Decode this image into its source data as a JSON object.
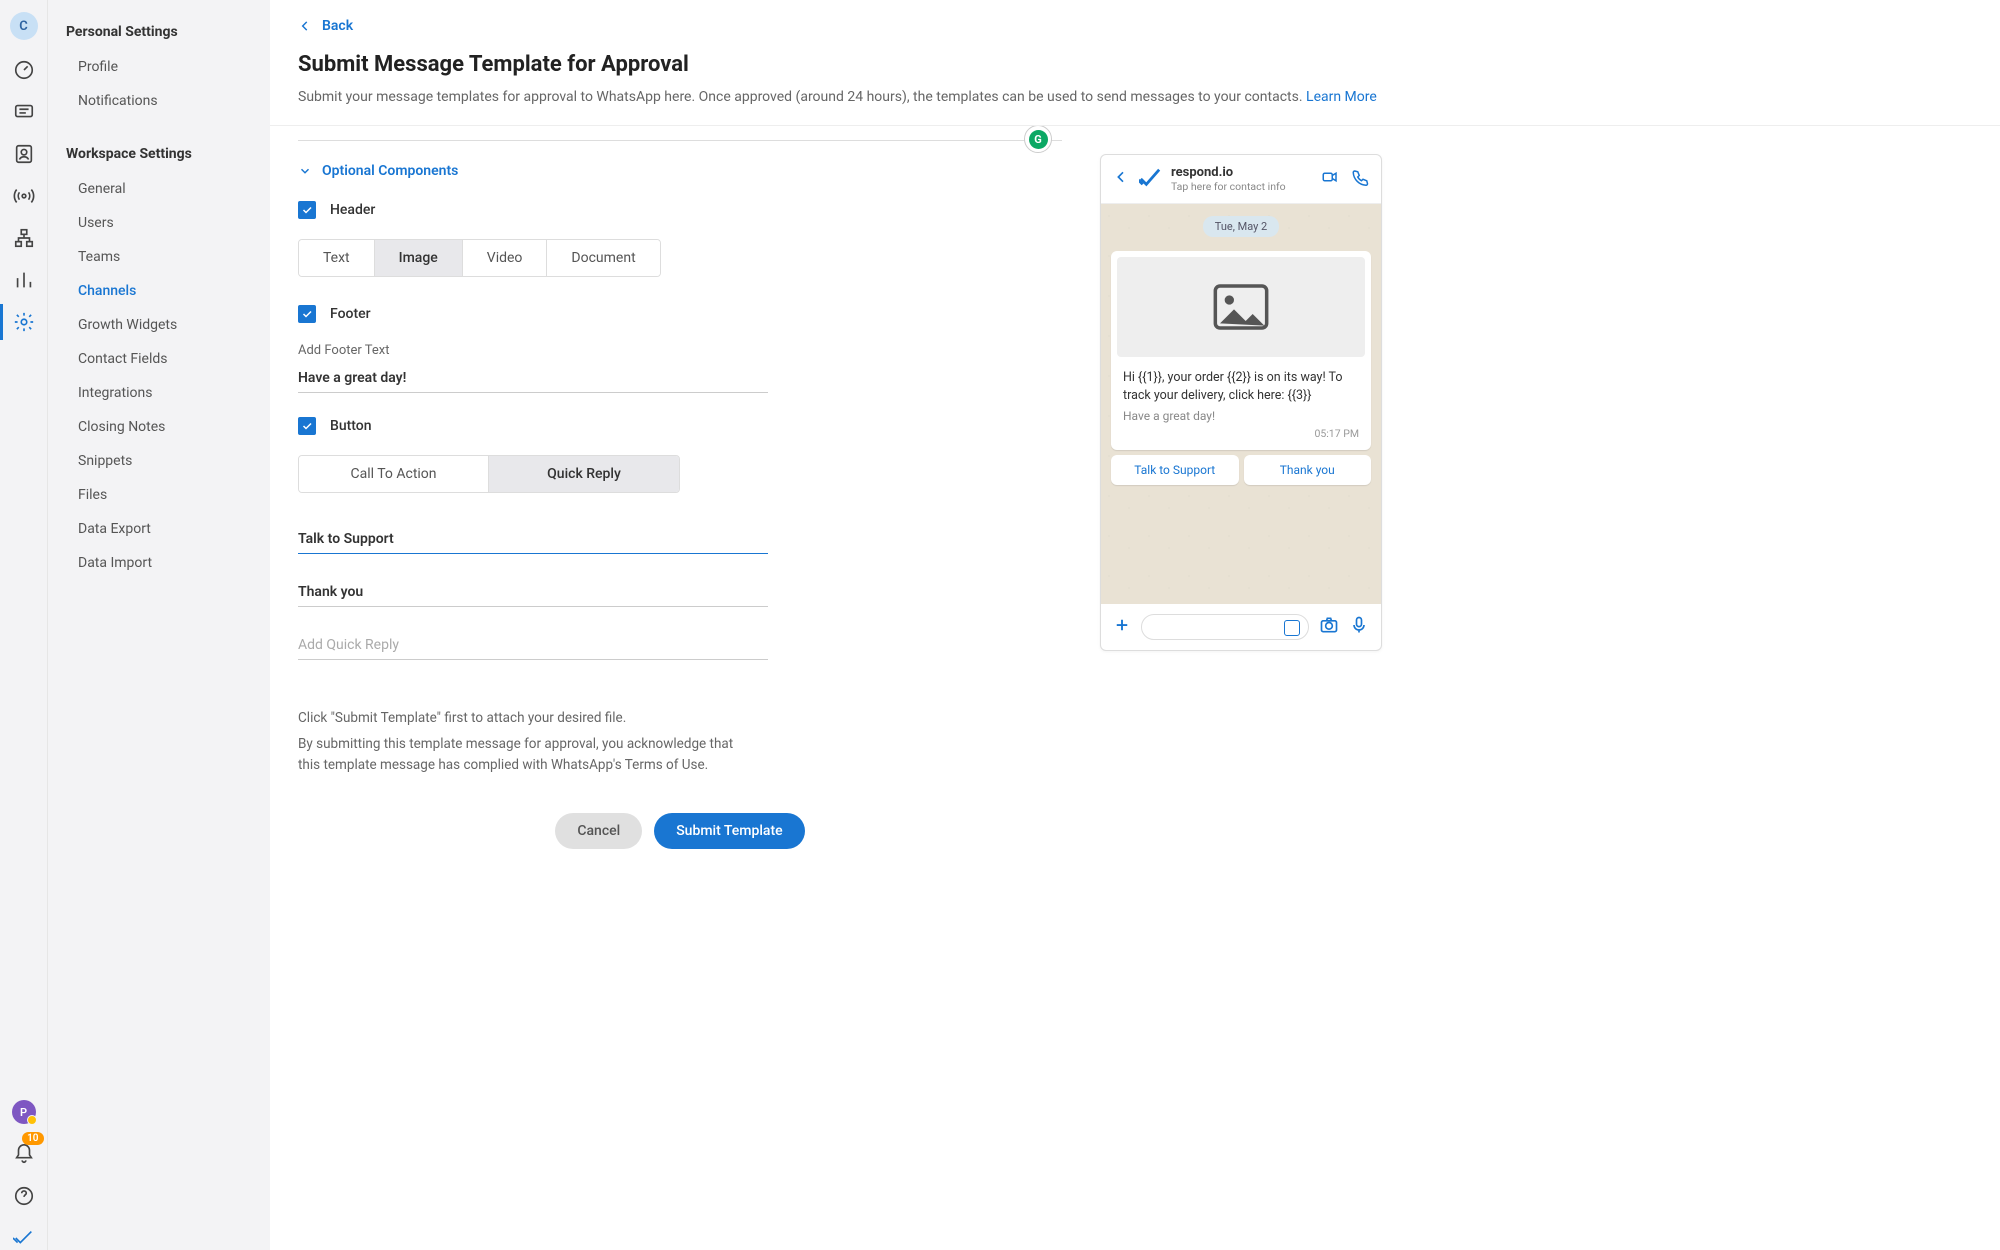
{
  "rail": {
    "initial": "C",
    "notif_count": "10",
    "p_initial": "P"
  },
  "sidebar": {
    "personal_title": "Personal Settings",
    "personal": [
      "Profile",
      "Notifications"
    ],
    "workspace_title": "Workspace Settings",
    "workspace": [
      "General",
      "Users",
      "Teams",
      "Channels",
      "Growth Widgets",
      "Contact Fields",
      "Integrations",
      "Closing Notes",
      "Snippets",
      "Files",
      "Data Export",
      "Data Import"
    ],
    "active": "Channels"
  },
  "header": {
    "back": "Back",
    "title": "Submit Message Template for Approval",
    "desc": "Submit your message templates for approval to WhatsApp here. Once approved (around 24 hours), the templates can be used to send messages to your contacts. ",
    "learn_more": "Learn More"
  },
  "form": {
    "green_badge": "G",
    "optional": "Optional Components",
    "header_label": "Header",
    "header_types": [
      "Text",
      "Image",
      "Video",
      "Document"
    ],
    "header_active": "Image",
    "footer_label": "Footer",
    "footer_field_label": "Add Footer Text",
    "footer_value": "Have a great day!",
    "button_label": "Button",
    "button_types": [
      "Call To Action",
      "Quick Reply"
    ],
    "button_active": "Quick Reply",
    "qr1": "Talk to Support",
    "qr2": "Thank you",
    "qr_placeholder": "Add Quick Reply",
    "helper1": "Click \"Submit Template\" first to attach your desired file.",
    "helper2": "By submitting this template message for approval, you acknowledge that this template message has complied with WhatsApp's Terms of Use.",
    "cancel": "Cancel",
    "submit": "Submit Template"
  },
  "preview": {
    "name": "respond.io",
    "sub": "Tap here for contact info",
    "date": "Tue, May 2",
    "body": "Hi {{1}}, your order {{2}} is on its way! To track your delivery, click here: {{3}}",
    "footer": "Have a great day!",
    "time": "05:17 PM",
    "btn1": "Talk to Support",
    "btn2": "Thank you"
  }
}
